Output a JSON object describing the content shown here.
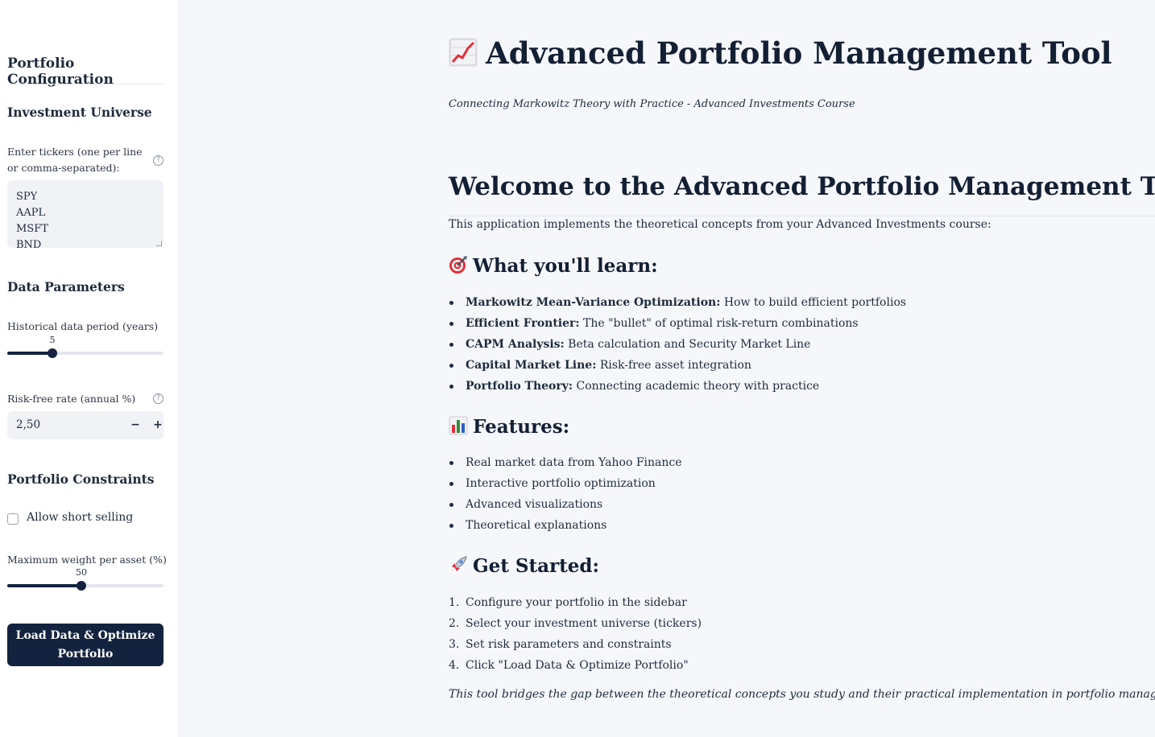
{
  "sidebar": {
    "title": "Portfolio Configuration",
    "universe_heading": "Investment Universe",
    "tickers_label": "Enter tickers (one per line or comma-separated):",
    "tickers_lines": [
      "SPY",
      "AAPL",
      "MSFT",
      "BND"
    ],
    "data_heading": "Data Parameters",
    "period_label": "Historical data period (years)",
    "period_value": "5",
    "period_fraction": 0.29,
    "risk_free_label": "Risk-free rate (annual %)",
    "risk_free_value": "2,50",
    "minus_label": "−",
    "plus_label": "+",
    "constraints_heading": "Portfolio Constraints",
    "short_selling_label": "Allow short selling",
    "short_selling_checked": false,
    "max_weight_label": "Maximum weight per asset (%)",
    "max_weight_value": "50",
    "max_weight_fraction": 0.475,
    "button_label": "Load Data & Optimize Portfolio",
    "help_glyph": "?"
  },
  "main": {
    "title": "Advanced Portfolio Management Tool",
    "title_icon": "chart-increasing-icon",
    "subtitle": "Connecting Markowitz Theory with Practice - Advanced Investments Course",
    "welcome_heading": "Welcome to the Advanced Portfolio Management Tool",
    "intro": "This application implements the theoretical concepts from your Advanced Investments course:",
    "learn_heading": "What you'll learn:",
    "learn_icon": "target-icon",
    "learn_items": [
      {
        "bold": "Markowitz Mean-Variance Optimization:",
        "text": " How to build efficient portfolios"
      },
      {
        "bold": "Efficient Frontier:",
        "text": " The \"bullet\" of optimal risk-return combinations"
      },
      {
        "bold": "CAPM Analysis:",
        "text": " Beta calculation and Security Market Line"
      },
      {
        "bold": "Capital Market Line:",
        "text": " Risk-free asset integration"
      },
      {
        "bold": "Portfolio Theory:",
        "text": " Connecting academic theory with practice"
      }
    ],
    "features_heading": "Features:",
    "features_icon": "bar-chart-icon",
    "features": [
      "Real market data from Yahoo Finance",
      "Interactive portfolio optimization",
      "Advanced visualizations",
      "Theoretical explanations"
    ],
    "start_heading": "Get Started:",
    "start_icon": "rocket-icon",
    "steps": [
      "Configure your portfolio in the sidebar",
      "Select your investment universe (tickers)",
      "Set risk parameters and constraints",
      "Click \"Load Data & Optimize Portfolio\""
    ],
    "footer_note": "This tool bridges the gap between the theoretical concepts you study and their practical implementation in portfolio management."
  },
  "colors": {
    "primary": "#13233f",
    "background": "#f5f7fb",
    "sidebar": "#ffffff",
    "input_bg": "#f0f2f6"
  }
}
